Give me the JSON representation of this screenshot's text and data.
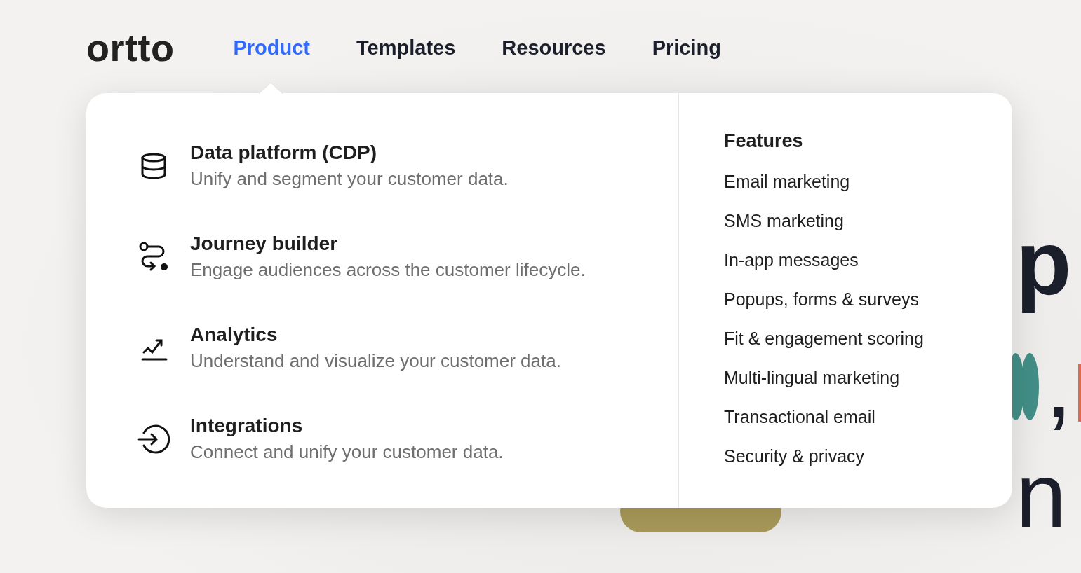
{
  "logo": "ortto",
  "nav": [
    {
      "label": "Product",
      "selected": true
    },
    {
      "label": "Templates",
      "selected": false
    },
    {
      "label": "Resources",
      "selected": false
    },
    {
      "label": "Pricing",
      "selected": false
    }
  ],
  "menu": {
    "products": [
      {
        "kind": "database",
        "title": "Data platform (CDP)",
        "description": "Unify and segment your customer data."
      },
      {
        "kind": "journey",
        "title": "Journey builder",
        "description": "Engage audiences across the customer lifecycle."
      },
      {
        "kind": "analytics",
        "title": "Analytics",
        "description": "Understand and visualize your customer data."
      },
      {
        "kind": "integrations",
        "title": "Integrations",
        "description": "Connect and unify your customer data."
      }
    ],
    "features_heading": "Features",
    "features": [
      "Email marketing",
      "SMS marketing",
      "In-app messages",
      "Popups, forms & surveys",
      "Fit & engagement scoring",
      "Multi-lingual marketing",
      "Transactional email",
      "Security & privacy"
    ]
  },
  "hero": {
    "line_1_letter": "p",
    "line_2_comma": ",",
    "line_3_letter": "n"
  }
}
